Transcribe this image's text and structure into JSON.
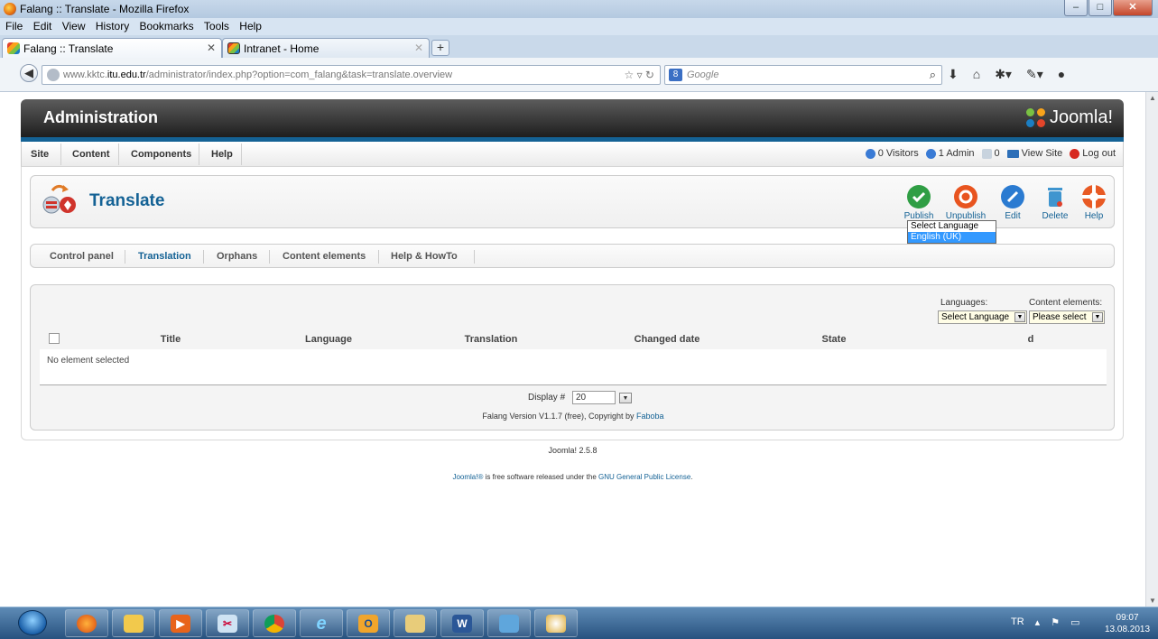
{
  "browser": {
    "window_title": "Falang :: Translate - Mozilla Firefox",
    "menu": [
      "File",
      "Edit",
      "View",
      "History",
      "Bookmarks",
      "Tools",
      "Help"
    ],
    "tabs": [
      {
        "label": "Falang :: Translate",
        "active": true
      },
      {
        "label": "Intranet - Home",
        "active": false
      }
    ],
    "url_prefix": "www.kktc.",
    "url_domain": "itu.edu.tr",
    "url_path": "/administrator/index.php?option=com_falang&task=translate.overview",
    "search_engine": "Google"
  },
  "admin": {
    "header_title": "Administration",
    "logo_text": "Joomla!",
    "menu": [
      "Site",
      "Content",
      "Components",
      "Help"
    ],
    "status": {
      "visitors": "0 Visitors",
      "admin": "1 Admin",
      "messages": "0",
      "view_site": "View Site",
      "logout": "Log out"
    }
  },
  "toolbar": {
    "page_title": "Translate",
    "buttons": [
      {
        "label": "Publish",
        "color": "#2f9e44",
        "icon": "check-icon"
      },
      {
        "label": "Unpublish",
        "color": "#e8541f",
        "icon": "unpublish-icon"
      },
      {
        "label": "Edit",
        "color": "#2b7bd1",
        "icon": "pencil-icon"
      },
      {
        "label": "Delete",
        "color": "#3f95cf",
        "icon": "trash-icon"
      },
      {
        "label": "Help",
        "color": "#e85a24",
        "icon": "lifebuoy-icon"
      }
    ]
  },
  "subnav": {
    "items": [
      "Control panel",
      "Translation",
      "Orphans",
      "Content elements",
      "Help & HowTo"
    ],
    "active": "Translation"
  },
  "filters": {
    "languages_label": "Languages:",
    "languages_selected": "Select Language",
    "languages_options": [
      "Select Language",
      "English (UK)"
    ],
    "content_elements_label": "Content elements:",
    "content_elements_selected": "Please select"
  },
  "table": {
    "columns": [
      "Title",
      "Language",
      "Translation",
      "Changed date",
      "State",
      "d"
    ],
    "empty_message": "No element selected"
  },
  "pagination": {
    "display_label": "Display #",
    "display_value": "20"
  },
  "version": {
    "text": "Falang Version V1.1.7 (free), Copyright by",
    "link": "Faboba"
  },
  "footer": {
    "joomla_version": "Joomla! 2.5.8",
    "license_prefix": "Joomla!®",
    "license_middle": " is free software released under the ",
    "license_link": "GNU General Public License",
    "license_suffix": "."
  },
  "taskbar": {
    "language": "TR",
    "time": "09:07",
    "date": "13.08.2013"
  }
}
